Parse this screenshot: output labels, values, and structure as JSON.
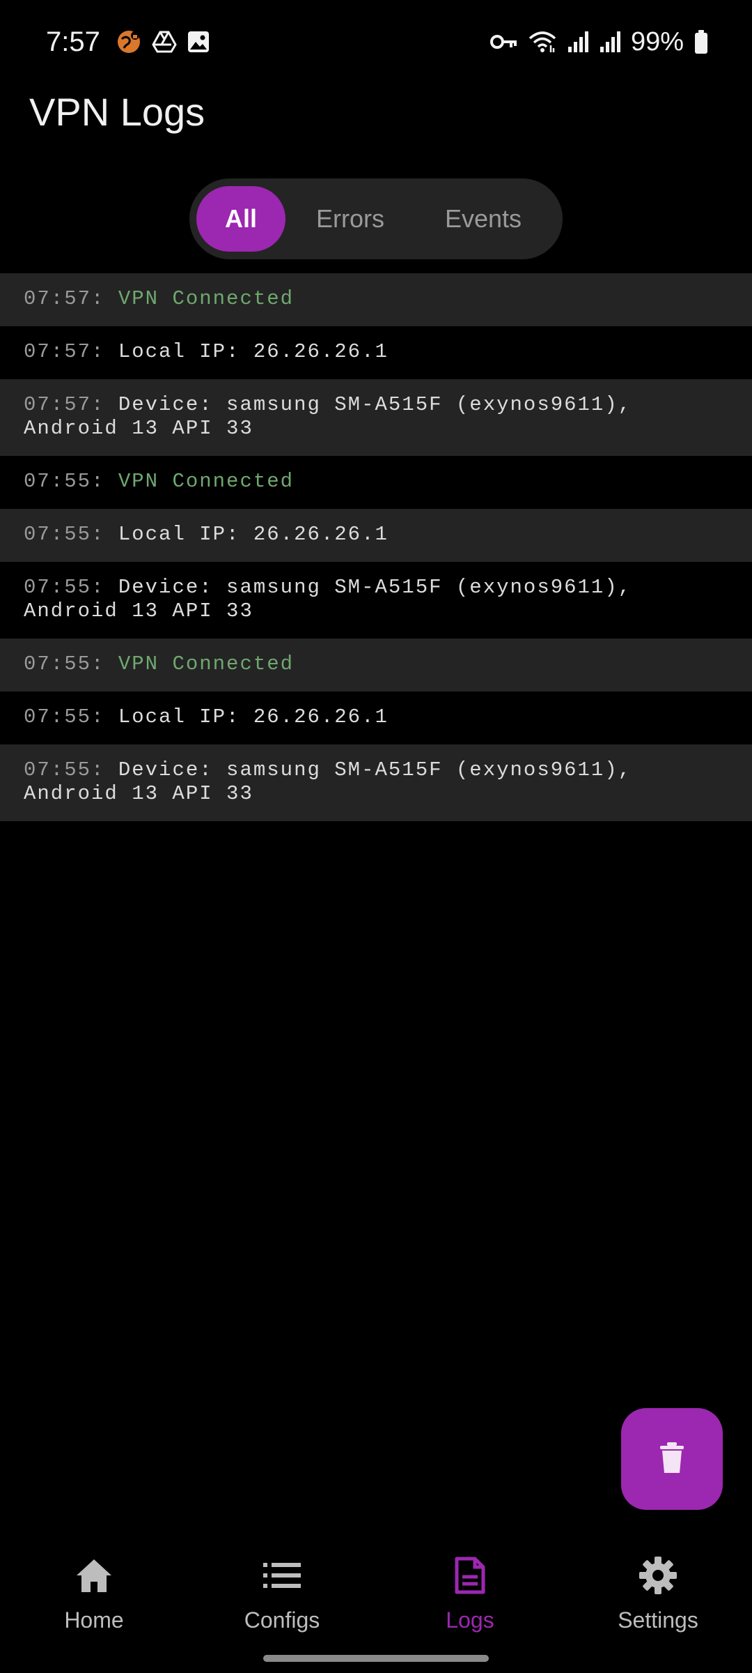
{
  "status_bar": {
    "time": "7:57",
    "battery": "99%",
    "left_icons": [
      "vpn-globe-icon",
      "drive-icon",
      "gallery-icon"
    ],
    "right_icons": [
      "vpn-key-icon",
      "wifi-icon",
      "signal-icon",
      "signal-icon",
      "battery-icon"
    ]
  },
  "page": {
    "title": "VPN Logs"
  },
  "filters": {
    "all": "All",
    "errors": "Errors",
    "events": "Events",
    "selected": "All"
  },
  "logs": [
    {
      "time": "07:57:",
      "message": "VPN Connected",
      "type": "success"
    },
    {
      "time": "07:57:",
      "message": "Local IP: 26.26.26.1",
      "type": "info"
    },
    {
      "time": "07:57:",
      "message": "Device: samsung SM-A515F (exynos9611), Android 13 API 33",
      "type": "info"
    },
    {
      "time": "07:55:",
      "message": "VPN Connected",
      "type": "success"
    },
    {
      "time": "07:55:",
      "message": "Local IP: 26.26.26.1",
      "type": "info"
    },
    {
      "time": "07:55:",
      "message": "Device: samsung SM-A515F (exynos9611), Android 13 API 33",
      "type": "info"
    },
    {
      "time": "07:55:",
      "message": "VPN Connected",
      "type": "success"
    },
    {
      "time": "07:55:",
      "message": "Local IP: 26.26.26.1",
      "type": "info"
    },
    {
      "time": "07:55:",
      "message": "Device: samsung SM-A515F (exynos9611), Android 13 API 33",
      "type": "info"
    }
  ],
  "fab": {
    "icon": "trash-icon"
  },
  "nav": {
    "home": "Home",
    "configs": "Configs",
    "logs": "Logs",
    "settings": "Settings",
    "active": "Logs"
  },
  "colors": {
    "accent": "#9c27b0",
    "success": "#6fa86f",
    "row_shade": "#242424",
    "background": "#000000"
  }
}
